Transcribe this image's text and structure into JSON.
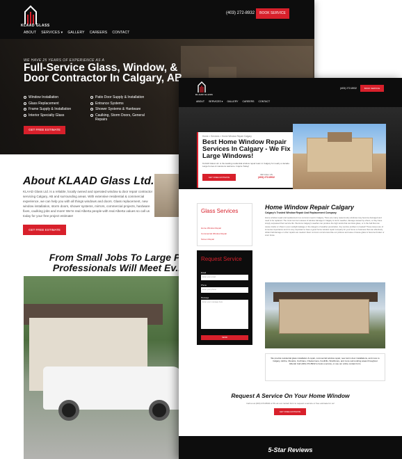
{
  "colors": {
    "accent": "#d8202b",
    "dark": "#0d0d0d"
  },
  "back_page": {
    "logo_text": "KLAAD GLASS",
    "phone": "(403) 272-8932",
    "book_service": "BOOK SERVICE",
    "nav": [
      "ABOUT",
      "SERVICES ▾",
      "GALLERY",
      "CAREERS",
      "CONTACT"
    ],
    "hero_kicker": "WE HAVE 25 YEARS OF EXPERIENCE AS A",
    "hero_title": "Full-Service Glass, Window, & Door Contractor In Calgary, AB",
    "services": [
      "Window Installation",
      "Patio Door Supply & Installation",
      "Glass Replacement",
      "Entrance Systems",
      "Frame Supply & Installation",
      "Shower Systems & Hardware",
      "Interior Specialty Glass",
      "Caulking, Storm Doors, General Repairs"
    ],
    "hero_button": "GET FREE ESTIMATE",
    "about_title": "About KLAAD Glass Ltd.",
    "about_text": "KLAAD Glass Ltd. is a reliable, locally owned and operated window & door repair contractor servicing Calgary, AB and surrounding areas. With extensive residential & commercial experience, we can help you with all things windows and doors. Glass replacement, new window installation, storm doors, shower systems, mirrors, commercial projects, hardware fixes, caulking jobs and more! We're real Alberta people with real Alberta values so call us today for your free project estimate!",
    "about_button": "GET FREE ESTIMATE",
    "section_title": "From Small Jobs To Large P... Professionals Will Meet Ev..."
  },
  "front_page": {
    "logo_text": "KLAAD GLASS",
    "phone": "(403) 272-8932",
    "book_service": "BOOK SERVICE",
    "nav": [
      "ABOUT",
      "SERVICES ▾",
      "GALLERY",
      "CAREERS",
      "CONTACT"
    ],
    "breadcrumb": "Home > Services > Home Window Repair Calgary",
    "hero_title": "Best Home Window Repair Services In Calgary - We Fix Large Windows!",
    "hero_sub": "KLAAD Glass Ltd. is the leading residential window repair team in Calgary for nearly a decade. Large homes & mansions welcome. Inquire Today!",
    "hero_button": "GET FREE ESTIMATE",
    "call_label": "OR CALL US",
    "call_number": "(403) 272-8932",
    "sidebar_title": "Glass Services",
    "sidebar_links": [
      "Home Window Repair",
      "Commercial Window Repair",
      "Screen Repair"
    ],
    "form_title": "Request Service",
    "form_labels": [
      "Email",
      "Phone",
      "Message"
    ],
    "form_placeholders": [
      "Enter your email",
      "Enter your phone",
      "Enter your message here"
    ],
    "form_button": "SEND",
    "main_title": "Home Window Repair Calgary",
    "main_subtitle": "Calgary's Trusted Window Repair And Replacement Company",
    "main_text": "Home window repair and replacement is a common need in Calgary. There are many reasons why windows may become damaged and need to be replaced. The most common causes of window damage in Calgary is storm weather, damage caused by others, or they have simply surpassed their service life. We know Calgary's weather can produce the high winds that can blow glass, or in the hail that can cause cracks or chips in even sunlight leakage or the dangers of weather penetration. Any service problem is treated! These issues are of immense importance and it is very important to have a good home window repair company for your home or business that can effectively obtain hail damage or other repairs are needed. Even common occurrences like our pictures and ease of cause glass to become broken or even loose.",
    "note_text": "We provide residential glass installation & repair, commercial window repair, new storm door installations, and more to Calgary, Airdrie, Okotoks, Cochrane, Chestermere, Foothills, Strathmore, and more surrounding areas throughout Alberta! Call (403) 272-8932 to book a service, or use our online contact form.",
    "request_title": "Request A Service On Your Home Window",
    "request_sub": "Call us at (403) 272-8932 or fill out our contact form to request a service or free estimate for us!",
    "request_button": "GET FREE ESTIMATE",
    "reviews_title": "5-Star Reviews"
  }
}
